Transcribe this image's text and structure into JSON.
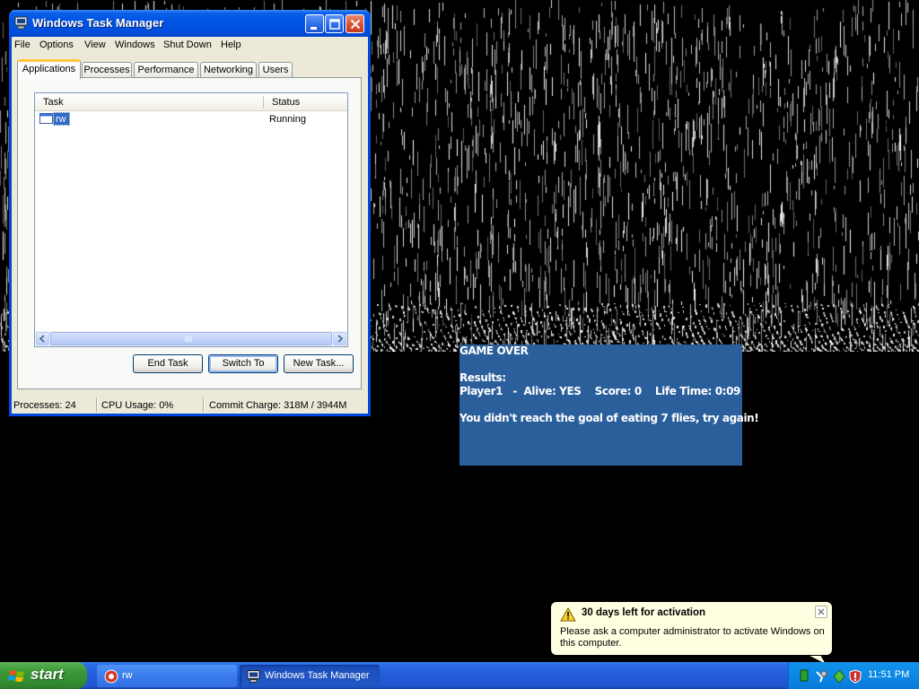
{
  "window": {
    "title": "Windows Task Manager",
    "menu": [
      "File",
      "Options",
      "View",
      "Windows",
      "Shut Down",
      "Help"
    ],
    "tabs": [
      "Applications",
      "Processes",
      "Performance",
      "Networking",
      "Users"
    ],
    "active_tab": "Applications",
    "columns": [
      "Task",
      "Status"
    ],
    "tasks": [
      {
        "name": "rw",
        "status": "Running"
      }
    ],
    "buttons": {
      "end_task": "End Task",
      "switch_to": "Switch To",
      "new_task": "New Task..."
    },
    "status": {
      "processes": "Processes: 24",
      "cpu": "CPU Usage: 0%",
      "commit": "Commit Charge: 318M / 3944M"
    }
  },
  "game": {
    "title": "GAME OVER",
    "results_label": "Results:",
    "player_line": "Player1   -  Alive: YES    Score: 0    Life Time: 0:09",
    "message": "You didn't reach the goal of eating 7 flies, try again!",
    "panel_color": "#2a5f9c"
  },
  "balloon": {
    "title": "30 days left for activation",
    "text": "Please ask a computer administrator to activate Windows on this computer.",
    "icon": "warning-icon"
  },
  "taskbar": {
    "start_label": "start",
    "items": [
      {
        "label": "rw",
        "icon": "game-app-icon",
        "active": false
      },
      {
        "label": "Windows Task Manager",
        "icon": "task-manager-icon",
        "active": true
      }
    ],
    "clock": "11:51 PM"
  },
  "colors": {
    "xp_blue": "#0054e3",
    "taskbar_blue": "#245edb",
    "start_green": "#3c9b39",
    "selection": "#316ac5"
  }
}
